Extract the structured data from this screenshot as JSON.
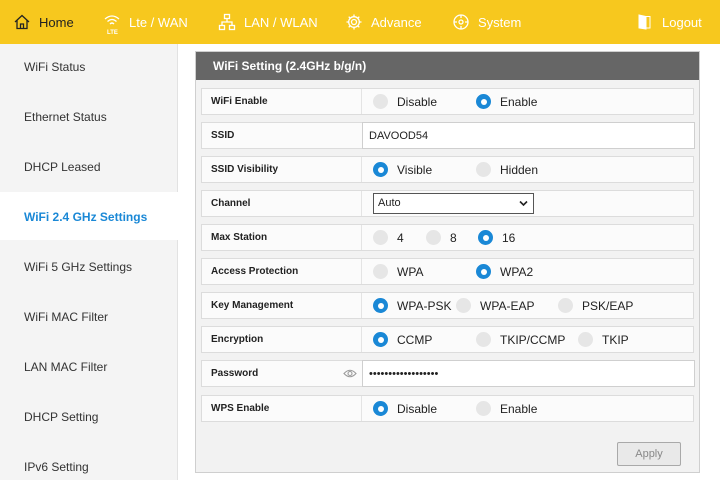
{
  "nav": {
    "home": "Home",
    "lte": "Lte / WAN",
    "lte_icon_text": "LTE",
    "lan": "LAN / WLAN",
    "advance": "Advance",
    "system": "System",
    "logout": "Logout"
  },
  "sidebar": {
    "items": [
      {
        "label": "WiFi Status"
      },
      {
        "label": "Ethernet Status"
      },
      {
        "label": "DHCP Leased"
      },
      {
        "label": "WiFi 2.4 GHz Settings"
      },
      {
        "label": "WiFi 5 GHz Settings"
      },
      {
        "label": "WiFi MAC Filter"
      },
      {
        "label": "LAN MAC Filter"
      },
      {
        "label": "DHCP Setting"
      },
      {
        "label": "IPv6 Setting"
      }
    ],
    "active": "WiFi 2.4 GHz Settings"
  },
  "panel": {
    "title": "WiFi Setting (2.4GHz b/g/n)",
    "rows": {
      "wifi_enable": {
        "label": "WiFi Enable",
        "options": [
          "Disable",
          "Enable"
        ],
        "selected": "Enable"
      },
      "ssid": {
        "label": "SSID",
        "value": "DAVOOD54"
      },
      "ssid_visibility": {
        "label": "SSID Visibility",
        "options": [
          "Visible",
          "Hidden"
        ],
        "selected": "Visible"
      },
      "channel": {
        "label": "Channel",
        "value": "Auto"
      },
      "max_station": {
        "label": "Max Station",
        "options": [
          "4",
          "8",
          "16"
        ],
        "selected": "16"
      },
      "access_protection": {
        "label": "Access Protection",
        "options": [
          "WPA",
          "WPA2"
        ],
        "selected": "WPA2"
      },
      "key_management": {
        "label": "Key Management",
        "options": [
          "WPA-PSK",
          "WPA-EAP",
          "PSK/EAP"
        ],
        "selected": "WPA-PSK"
      },
      "encryption": {
        "label": "Encryption",
        "options": [
          "CCMP",
          "TKIP/CCMP",
          "TKIP"
        ],
        "selected": "CCMP"
      },
      "password": {
        "label": "Password",
        "value": "••••••••••••••••••"
      },
      "wps_enable": {
        "label": "WPS Enable",
        "options": [
          "Disable",
          "Enable"
        ],
        "selected": "Disable"
      }
    },
    "apply_label": "Apply"
  },
  "colors": {
    "topbar": "#f7c81e",
    "accent": "#1a88d6",
    "panel_header": "#666666"
  }
}
